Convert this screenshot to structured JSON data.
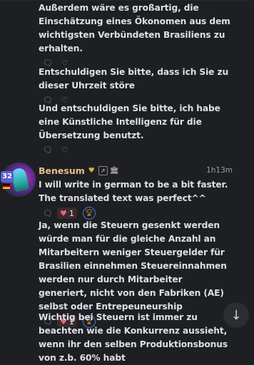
{
  "messages_top": [
    {
      "text": "Außerdem wäre es großartig, die Einschätzung eines Ökonomen aus dem wichtigsten Verbündeten Brasiliens zu erhalten."
    },
    {
      "text": "Entschuldigen Sie bitte, dass ich Sie zu dieser Uhrzeit störe"
    },
    {
      "text": "Und entschuldigen Sie bitte, ich habe eine Künstliche Intelligenz für die Übersetzung benutzt."
    }
  ],
  "author": {
    "username": "Benesum",
    "level": "32",
    "timestamp": "1h13m"
  },
  "messages_bottom": [
    {
      "text": "I will write in german to be a bit faster.  The translated text was perfect^^",
      "heart_count": "1"
    },
    {
      "text": "Ja, wenn die Steuern gesenkt werden würde man für die gleiche Anzahl an Mitarbeitern weniger Steuergelder für Brasilien einnehmen Steuereinnahmen werden nur durch Mitarbeiter generiert, nicht von den Fabriken (AE) selbst oder Entrepeuneurship",
      "heart_count": "1"
    },
    {
      "text": "Wichtig bei Steuern ist immer zu beachten wie die Konkurrenz aussieht, wenn ihr den selben Produktionsbonus von z.b. 60% habt"
    }
  ],
  "icons": {
    "comment": "comment-icon",
    "like": "heart-icon",
    "scroll": "arrow-down-icon"
  },
  "colors": {
    "background": "#1e1f22",
    "username": "#e4c08a",
    "heart": "#e8646f",
    "level_badge": "#5b61c9"
  }
}
